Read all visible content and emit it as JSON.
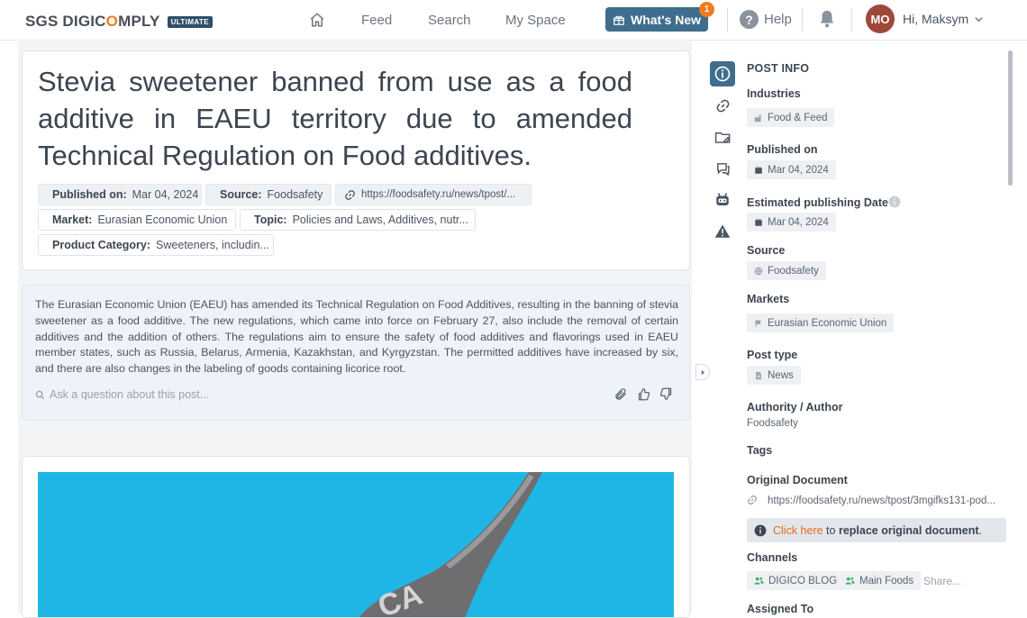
{
  "header": {
    "logo_main": "SGS DIGIC",
    "logo_o": "O",
    "logo_tail": "MPLY",
    "logo_badge": "ULTIMATE",
    "nav": [
      "Feed",
      "Search",
      "My Space"
    ],
    "whats_new": "What's New",
    "whats_new_count": "1",
    "help": "Help",
    "avatar_initials": "MO",
    "greeting": "Hi, Maksym"
  },
  "article": {
    "title": "Stevia sweetener banned from use as a food additive in EAEU territory due to amended Technical Regulation on Food additives.",
    "published_label": "Published on:",
    "published_value": "Mar 04, 2024",
    "source_label": "Source:",
    "source_value": "Foodsafety",
    "url": "https://foodsafety.ru/news/tpost/...",
    "market_label": "Market:",
    "market_value": "Eurasian Economic Union",
    "topic_label": "Topic:",
    "topic_value": "Policies and Laws, Additives, nutr...",
    "product_label": "Product Category:",
    "product_value": "Sweeteners, includin..."
  },
  "summary": {
    "text": "The Eurasian Economic Union (EAEU) has amended its Technical Regulation on Food Additives, resulting in the banning of stevia sweetener as a food additive. The new regulations, which came into force on February 27, also include the removal of certain additives and the addition of others. The regulations aim to ensure the safety of food additives and flavorings used in EAEU member states, such as Russia, Belarus, Armenia, Kazakhstan, and Kyrgyzstan. The permitted additives have increased by six, and there are also changes in the labeling of goods containing licorice root.",
    "ask_placeholder": "Ask a question about this post..."
  },
  "post_info": {
    "heading": "POST INFO",
    "industries_label": "Industries",
    "industries_value": "Food & Feed",
    "published_label": "Published on",
    "published_value": "Mar 04, 2024",
    "estimated_label": "Estimated publishing Date",
    "estimated_value": "Mar 04, 2024",
    "source_label": "Source",
    "source_value": "Foodsafety",
    "markets_label": "Markets",
    "markets_value": "Eurasian Economic Union",
    "post_type_label": "Post type",
    "post_type_value": "News",
    "authority_label": "Authority / Author",
    "authority_value": "Foodsafety",
    "tags_label": "Tags",
    "original_label": "Original Document",
    "original_value": "https://foodsafety.ru/news/tpost/3mgifks131-pod...",
    "click_here": "Click here",
    "info_mid": " to ",
    "replace_text": "replace original document",
    "info_end": ".",
    "channels_label": "Channels",
    "channel_1": "DIGICO BLOG",
    "channel_2": "Main Foods",
    "share": "Share...",
    "assigned_label": "Assigned To"
  },
  "colors": {
    "accent": "#3f6d8c",
    "orange": "#f07b1f",
    "image_bg": "#1fb6e6"
  }
}
